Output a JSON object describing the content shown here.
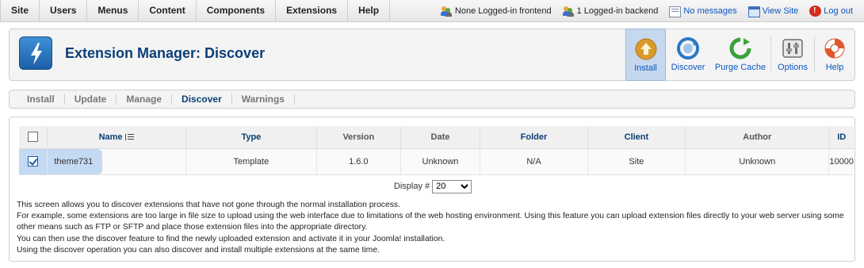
{
  "menu": [
    "Site",
    "Users",
    "Menus",
    "Content",
    "Components",
    "Extensions",
    "Help"
  ],
  "status": {
    "frontend": "None Logged-in frontend",
    "backend": "1 Logged-in backend",
    "messages": "No messages",
    "view_site": "View Site",
    "logout": "Log out"
  },
  "header": {
    "title": "Extension Manager: Discover"
  },
  "toolbar": {
    "install": "Install",
    "discover": "Discover",
    "purge_cache": "Purge Cache",
    "options": "Options",
    "help": "Help"
  },
  "tabs": [
    "Install",
    "Update",
    "Manage",
    "Discover",
    "Warnings"
  ],
  "active_tab": "Discover",
  "table": {
    "headers": {
      "name": "Name",
      "type": "Type",
      "version": "Version",
      "date": "Date",
      "folder": "Folder",
      "client": "Client",
      "author": "Author",
      "id": "ID"
    },
    "rows": [
      {
        "name": "theme731",
        "type": "Template",
        "version": "1.6.0",
        "date": "Unknown",
        "folder": "N/A",
        "client": "Site",
        "author": "Unknown",
        "id": "10000"
      }
    ]
  },
  "display": {
    "label": "Display #",
    "value": "20"
  },
  "description": [
    "This screen allows you to discover extensions that have not gone through the normal installation process.",
    "For example, some extensions are too large in file size to upload using the web interface due to limitations of the web hosting environment. Using this feature you can upload extension files directly to your web server using some other means such as FTP or SFTP and place those extension files into the appropriate directory.",
    "You can then use the discover feature to find the newly uploaded extension and activate it in your Joomla! installation.",
    "Using the discover operation you can also discover and install multiple extensions at the same time."
  ],
  "colors": {
    "title": "#0b3f77",
    "link": "#0b55c4",
    "selected": "#c4d9f2"
  }
}
